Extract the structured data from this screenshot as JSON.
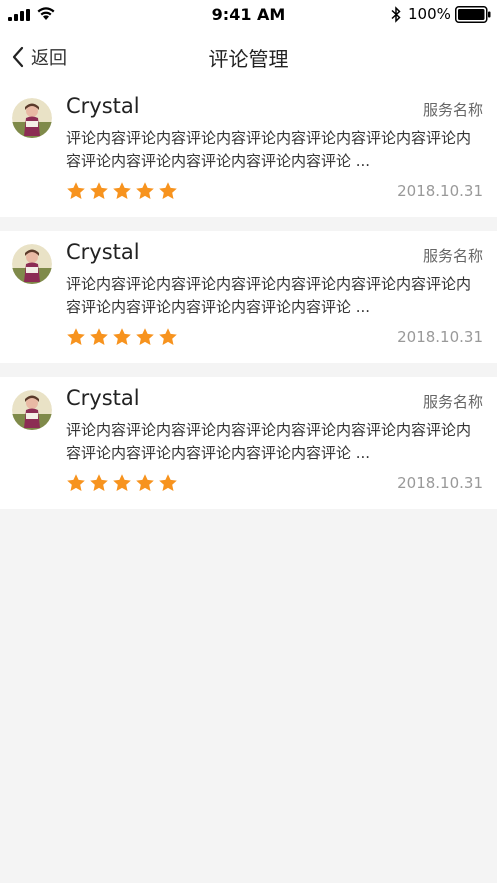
{
  "statusbar": {
    "time": "9:41 AM",
    "battery": "100%"
  },
  "nav": {
    "back_label": "返回",
    "title": "评论管理"
  },
  "reviews": [
    {
      "name": "Crystal",
      "service": "服务名称",
      "content": "评论内容评论内容评论内容评论内容评论内容评论内容评论内容评论内容评论内容评论内容评论内容评论 ...",
      "rating": 5,
      "date": "2018.10.31"
    },
    {
      "name": "Crystal",
      "service": "服务名称",
      "content": "评论内容评论内容评论内容评论内容评论内容评论内容评论内容评论内容评论内容评论内容评论内容评论 ...",
      "rating": 5,
      "date": "2018.10.31"
    },
    {
      "name": "Crystal",
      "service": "服务名称",
      "content": "评论内容评论内容评论内容评论内容评论内容评论内容评论内容评论内容评论内容评论内容评论内容评论 ...",
      "rating": 5,
      "date": "2018.10.31"
    }
  ],
  "colors": {
    "star": "#f7931e",
    "background": "#f4f4f4"
  }
}
